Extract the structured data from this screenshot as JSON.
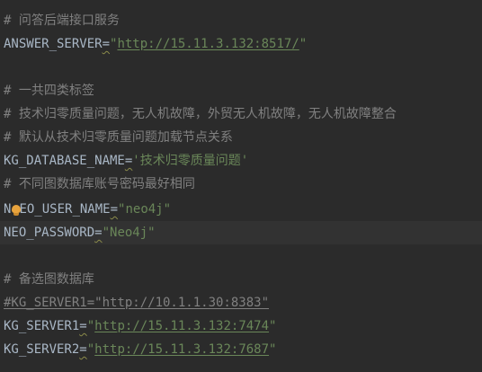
{
  "lines": {
    "l1": "# 问答后端接口服务",
    "l2_key": "ANSWER_SERVER",
    "l2_eq": "=",
    "l2_q1": "\"",
    "l2_url": "http://15.11.3.132:8517/",
    "l2_q2": "\"",
    "l4": "# 一共四类标签",
    "l5": "# 技术归零质量问题，无人机故障，外贸无人机故障，无人机故障整合",
    "l6": "# 默认从技术归零质量问题加载节点关系",
    "l7_key": "KG_DATABASE_NAME",
    "l7_eq": "=",
    "l7_val": "'技术归零质量问题'",
    "l8": "# 不同图数据库账号密码最好相同",
    "l9_key_a": "N",
    "l9_key_b": "EO_USER_NAME",
    "l9_eq": "=",
    "l9_val": "\"neo4j\"",
    "l10_key": "NEO_PASSWORD",
    "l10_eq": "=",
    "l10_val": "\"Neo4j\"",
    "l12": "# 备选图数据库",
    "l13": "#KG_SERVER1=\"http://10.1.1.30:8383\"",
    "l14_key": "KG_SERVER1",
    "l14_eq": "=",
    "l14_q1": "\"",
    "l14_url": "http://15.11.3.132:7474",
    "l14_q2": "\"",
    "l15_key": "KG_SERVER2",
    "l15_eq": "=",
    "l15_q1": "\"",
    "l15_url": "http://15.11.3.132:7687",
    "l15_q2": "\""
  },
  "icons": {
    "intention_bulb": "lightbulb-icon"
  },
  "colors": {
    "background": "#2b2b2b",
    "current_line": "#323232",
    "text": "#a9b7c6",
    "comment": "#808080",
    "string": "#6a8759",
    "bulb": "#e8a33d"
  }
}
